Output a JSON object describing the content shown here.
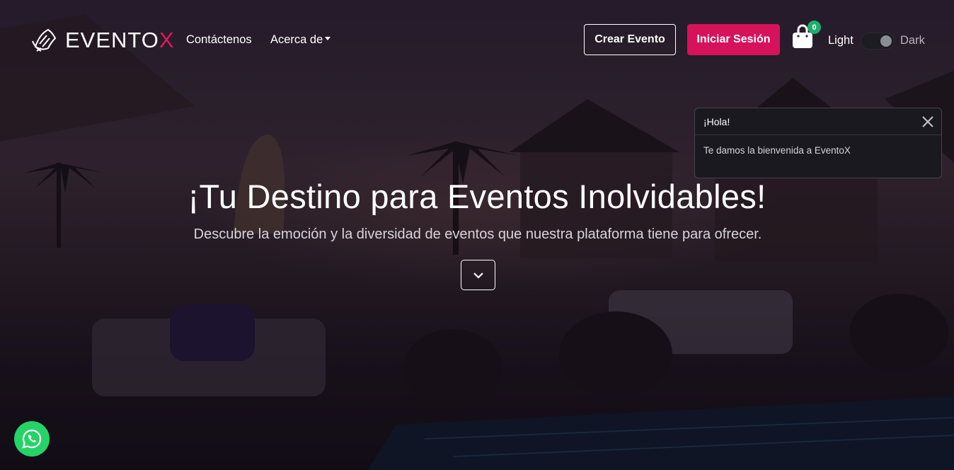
{
  "brand": {
    "name_main": "EVENTO",
    "name_accent": "X",
    "accent_color": "#e0195c"
  },
  "nav": {
    "contact_label": "Contáctenos",
    "about_label": "Acerca de",
    "create_event_label": "Crear Evento",
    "login_label": "Iniciar Sesión",
    "cart_count": "0",
    "theme_light_label": "Light",
    "theme_dark_label": "Dark"
  },
  "toast": {
    "title": "¡Hola!",
    "message": "Te damos la bienvenida a EventoX"
  },
  "hero": {
    "title": "¡Tu Destino para Eventos Inolvidables!",
    "subtitle": "Descubre la emoción y la diversidad de eventos que nuestra plataforma tiene para ofrecer."
  },
  "icons": {
    "logo": "eventox-logo-icon",
    "cart": "shopping-bag-icon",
    "close": "close-icon",
    "scroll": "chevron-down-icon",
    "whatsapp": "whatsapp-icon"
  },
  "colors": {
    "primary": "#d6125a",
    "badge": "#1fae6b",
    "whatsapp": "#25d366"
  }
}
